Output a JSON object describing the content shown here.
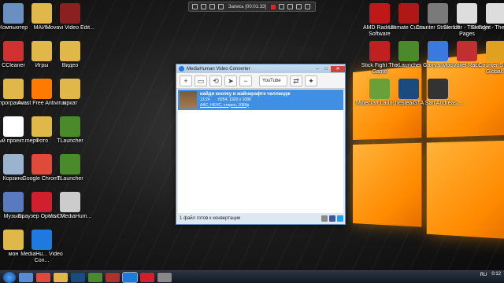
{
  "recorder": {
    "status_text": "Запись [00:01:33]"
  },
  "desktop": {
    "left_icons": [
      {
        "label": "Компьютер",
        "icon": "computer-icon",
        "color": "#6a8fc0"
      },
      {
        "label": "МАЙН",
        "icon": "folder-icon",
        "color": "#e0b84a"
      },
      {
        "label": "Movavi Video Edit...",
        "icon": "movavi-icon",
        "color": "#8a2020"
      },
      {
        "label": "CCleaner",
        "icon": "ccleaner-icon",
        "color": "#d03030"
      },
      {
        "label": "Игры",
        "icon": "folder-icon",
        "color": "#e0b84a"
      },
      {
        "label": "Видео",
        "icon": "folder-icon",
        "color": "#e0b84a"
      },
      {
        "label": "программы",
        "icon": "folder-icon",
        "color": "#e0b84a"
      },
      {
        "label": "Avast Free Antivirus",
        "icon": "avast-icon",
        "color": "#ff7a00"
      },
      {
        "label": "мркат",
        "icon": "folder-icon",
        "color": "#e0b84a"
      },
      {
        "label": "Новый проект.mepx",
        "icon": "document-icon",
        "color": "#ffffff"
      },
      {
        "label": "Фото",
        "icon": "folder-icon",
        "color": "#e0b84a"
      },
      {
        "label": "TLauncher",
        "icon": "minecraft-icon",
        "color": "#4a8a2a"
      },
      {
        "label": "Корзина",
        "icon": "recycle-bin-icon",
        "color": "#9ab4d0"
      },
      {
        "label": "Google Chrome",
        "icon": "chrome-icon",
        "color": "#e04a3a"
      },
      {
        "label": "TLauncher",
        "icon": "minecraft-icon",
        "color": "#4a8a2a"
      },
      {
        "label": "Музыка",
        "icon": "music-folder-icon",
        "color": "#5a7ac0"
      },
      {
        "label": "Браузер Opera GX",
        "icon": "opera-icon",
        "color": "#d02030"
      },
      {
        "label": "Visit MediaHum...",
        "icon": "microphone-icon",
        "color": "#cccccc"
      },
      {
        "label": "мон",
        "icon": "folder-icon",
        "color": "#e0b84a"
      },
      {
        "label": "MediaHu... Video Con...",
        "icon": "mediahuman-icon",
        "color": "#1f7ae0"
      }
    ],
    "right_icons": [
      {
        "label": "AMD Radeon Software",
        "icon": "amd-icon",
        "color": "#c01818"
      },
      {
        "label": "Ultimate Custo...",
        "icon": "game-icon",
        "color": "#b01818"
      },
      {
        "label": "Counter Strike 1.6",
        "icon": "cs-icon",
        "color": "#7a7a7a"
      },
      {
        "label": "Slender - The Eight Pages",
        "icon": "slender-icon",
        "color": "#dddddd"
      },
      {
        "label": "Slender - The Arrival",
        "icon": "slender-icon",
        "color": "#dddddd"
      },
      {
        "label": "Stick Fight The Game",
        "icon": "game-icon",
        "color": "#c02020"
      },
      {
        "label": "xLauncher",
        "icon": "minecraft-icon",
        "color": "#4a8a2a"
      },
      {
        "label": "Garry's Mod",
        "icon": "gmod-icon",
        "color": "#3a7ae0"
      },
      {
        "label": "Voxel Race",
        "icon": "voxel-icon",
        "color": "#c03030"
      },
      {
        "label": "Counter-Strike Global...",
        "icon": "csgo-icon",
        "color": "#e0a020"
      },
      {
        "label": "Minecraft Launcher",
        "icon": "minecraft-icon",
        "color": "#6aa03a"
      },
      {
        "label": "Steam",
        "icon": "steam-icon",
        "color": "#1b4a80"
      },
      {
        "label": "GTA San Andreas ...",
        "icon": "gta-icon",
        "color": "#333333"
      }
    ]
  },
  "app": {
    "title": "MediaHuman Video Converter",
    "toolbar": {
      "add": "+",
      "remove": "−",
      "format_select": "YouTube"
    },
    "item": {
      "title": "найди кнопку в майнкрафте челлендж",
      "duration": "13:24",
      "codec": "H264, 1920 x 1080",
      "format": "AAC, HEVC, стерео, 1080p"
    },
    "status": "1 файл готов к конвертации"
  },
  "taskbar": {
    "language": "RU",
    "time": "0:12"
  }
}
